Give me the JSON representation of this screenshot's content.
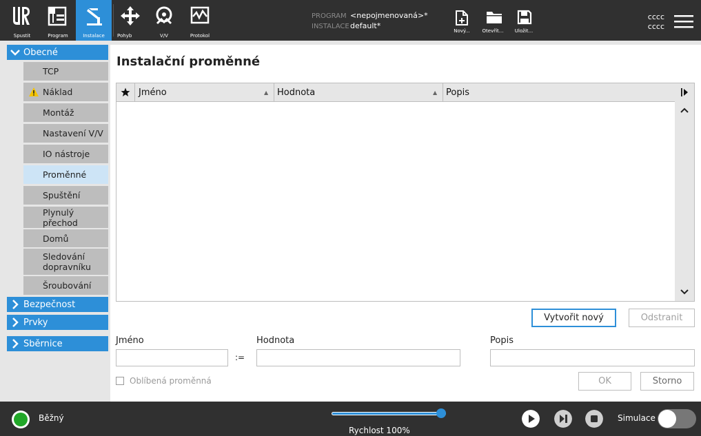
{
  "header": {
    "nav": [
      {
        "label": "Spustit",
        "icon": "ur-logo-icon"
      },
      {
        "label": "Program",
        "icon": "program-icon"
      },
      {
        "label": "Instalace",
        "icon": "installation-icon",
        "active": true
      },
      {
        "label": "Pohyb",
        "icon": "move-icon"
      },
      {
        "label": "V/V",
        "icon": "io-icon"
      },
      {
        "label": "Protokol",
        "icon": "log-icon"
      }
    ],
    "program_key": "PROGRAM",
    "program_value": "<nepojmenovaná>*",
    "installation_key": "INSTALACE",
    "installation_value": "default*",
    "file_buttons": [
      {
        "label": "Nový...",
        "icon": "new-file-icon"
      },
      {
        "label": "Otevřít...",
        "icon": "folder-icon"
      },
      {
        "label": "Uložit...",
        "icon": "save-icon"
      }
    ],
    "user_line1": "cccc",
    "user_line2": "cccc",
    "accent": "#2d8fd8"
  },
  "sidebar": {
    "groups": [
      {
        "label": "Obecné",
        "expanded": true
      },
      {
        "label": "Bezpečnost"
      },
      {
        "label": "Prvky"
      },
      {
        "label": "Sběrnice"
      }
    ],
    "items": [
      {
        "label": "TCP"
      },
      {
        "label": "Náklad",
        "warning": true
      },
      {
        "label": "Montáž"
      },
      {
        "label": "Nastavení V/V"
      },
      {
        "label": "IO nástroje"
      },
      {
        "label": "Proměnné",
        "selected": true
      },
      {
        "label": "Spuštění"
      },
      {
        "label": "Plynulý přechod"
      },
      {
        "label": "Domů"
      },
      {
        "label": "Sledování dopravníku"
      },
      {
        "label": "Šroubování"
      }
    ]
  },
  "main": {
    "title": "Instalační proměnné",
    "table": {
      "columns": [
        "Jméno",
        "Hodnota",
        "Popis"
      ],
      "rows": []
    },
    "create_button": "Vytvořit nový",
    "remove_button": "Odstranit",
    "form": {
      "name_label": "Jméno",
      "assign_op": ":=",
      "value_label": "Hodnota",
      "desc_label": "Popis",
      "name_value": "",
      "value_value": "",
      "desc_value": "",
      "favorite_label": "Oblíbená proměnná",
      "favorite_checked": false
    },
    "ok_button": "OK",
    "cancel_button": "Storno"
  },
  "footer": {
    "status": "Běžný",
    "status_color": "#21a728",
    "speed_label": "Rychlost 100%",
    "speed_fraction": 1.0,
    "simulation_label": "Simulace",
    "simulation_on": false
  }
}
